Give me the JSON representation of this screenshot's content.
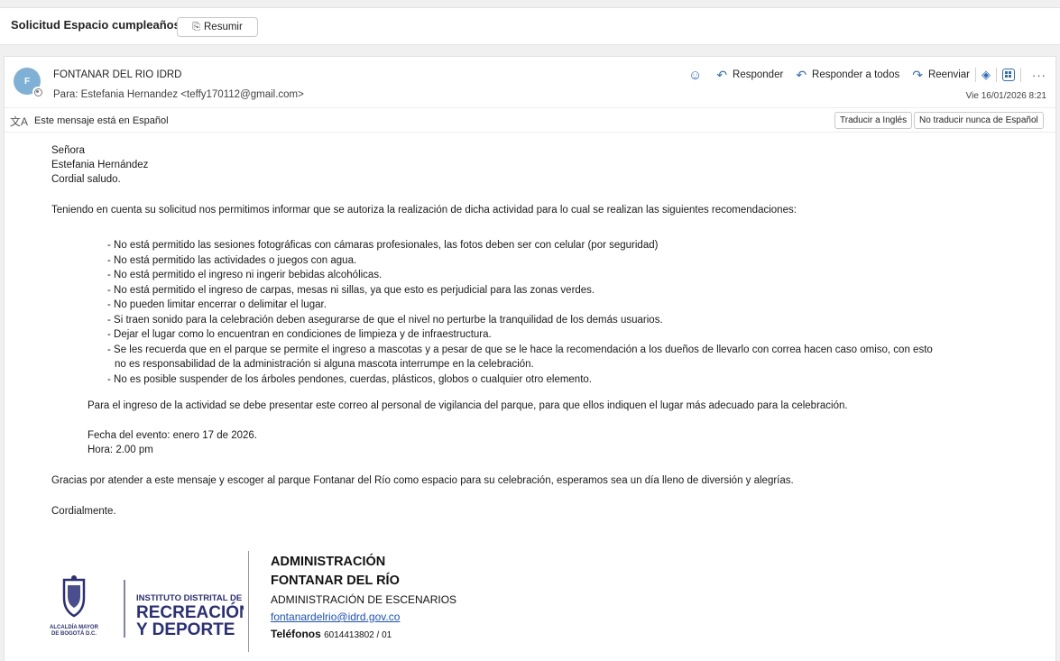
{
  "subject": {
    "title": "Solicitud Espacio cumpleaños",
    "summarize_label": "Resumir"
  },
  "message": {
    "avatar_initial": "F",
    "sender": "FONTANAR DEL RIO IDRD",
    "to": "Para:  Estefania Hernandez <teffy170112@gmail.com>",
    "date": "Vie 16/01/2026 8:21",
    "actions": {
      "reply": "Responder",
      "reply_all": "Responder a todos",
      "forward": "Reenviar"
    },
    "icons": [
      "emoji-icon",
      "reply-icon",
      "reply-all-icon",
      "forward-icon",
      "copilot-icon",
      "apps-icon",
      "more-icon"
    ]
  },
  "translation": {
    "notice": "Este mensaje está en Español",
    "translate_button": "Traducir a Inglés",
    "never_button": "No traducir nunca de Español"
  },
  "body": {
    "salutation_1": "Señora",
    "salutation_2": "Estefania Hernández",
    "salutation_3": "Cordial saludo.",
    "intro": "Teniendo en cuenta su solicitud nos permitimos informar que se autoriza la realización de dicha actividad para lo cual se realizan las siguientes recomendaciones:",
    "rules": [
      "- No está permitido las sesiones fotográficas con cámaras profesionales, las fotos deben ser con celular (por seguridad)",
      "- No está permitido las actividades o juegos con agua.",
      "- No está permitido el ingreso ni ingerir bebidas alcohólicas.",
      "- No está permitido el ingreso de carpas, mesas ni sillas, ya que esto es perjudicial para las zonas verdes.",
      "- No pueden limitar encerrar o delimitar el lugar.",
      "- Si traen sonido para la celebración deben asegurarse de que el nivel no perturbe la tranquilidad de los demás usuarios.",
      "- Dejar el lugar como lo encuentran en condiciones de limpieza y de infraestructura.",
      "- Se les recuerda que en el parque se permite el ingreso a mascotas y a pesar de que se le hace la recomendación a los dueños de llevarlo con correa hacen caso omiso, con esto",
      "no es responsabilidad de la administración si alguna mascota interrumpe en la celebración.",
      "- No es posible suspender de los árboles pendones, cuerdas, plásticos, globos o cualquier otro elemento."
    ],
    "entry_note": "Para el ingreso de la actividad se debe presentar este correo al personal de vigilancia del parque, para que ellos indiquen el lugar más adecuado para la celebración.",
    "event_date": "Fecha del evento: enero 17 de 2026.",
    "event_time": "Hora: 2.00 pm",
    "thanks": "Gracias por atender a este mensaje y escoger al parque Fontanar del Río como espacio para su celebración, esperamos sea un día lleno de diversión y alegrías.",
    "closing": "Cordialmente."
  },
  "signature": {
    "logo_text_1": "INSTITUTO DISTRITAL DE",
    "logo_text_2": "RECREACIÓN",
    "logo_text_3": "Y DEPORTE",
    "logo_city_1": "ALCALDÍA MAYOR",
    "logo_city_2": "DE BOGOTÁ D.C.",
    "name_1": "ADMINISTRACIÓN",
    "name_2": "FONTANAR DEL RÍO",
    "role": "ADMINISTRACIÓN DE ESCENARIOS",
    "email": "fontanardelrio@idrd.gov.co",
    "phone_label": "Teléfonos",
    "phone_value": "6014413802 / 01",
    "brand_color": "#1f2a6b"
  }
}
